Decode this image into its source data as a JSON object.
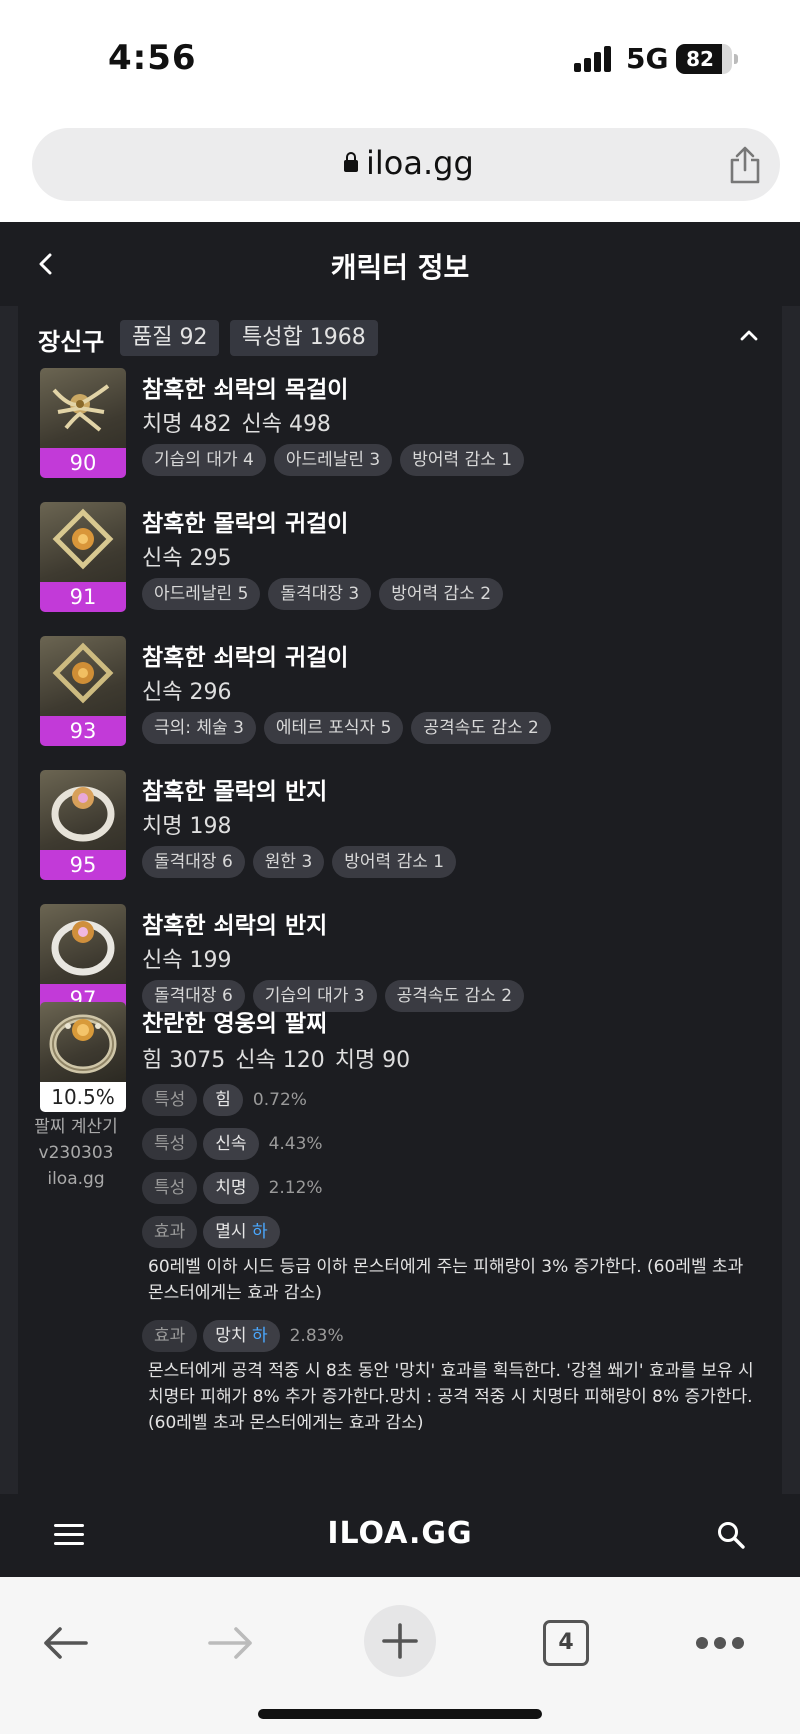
{
  "status": {
    "time": "4:56",
    "network": "5G",
    "battery": "82",
    "battery_level": 0.82
  },
  "browser": {
    "url": "iloa.gg",
    "tab_count": "4"
  },
  "header": {
    "title": "캐릭터 정보"
  },
  "section": {
    "title": "장신구",
    "quality": "품질 92",
    "stat_total": "특성합 1968"
  },
  "accessories": [
    {
      "name": "참혹한 쇠락의 목걸이",
      "quality": "90",
      "stats": [
        "치명 482",
        "신속 498"
      ],
      "engravings": [
        "기습의 대가 4",
        "아드레날린 3",
        "방어력 감소 1"
      ]
    },
    {
      "name": "참혹한 몰락의 귀걸이",
      "quality": "91",
      "stats": [
        "신속 295"
      ],
      "engravings": [
        "아드레날린 5",
        "돌격대장 3",
        "방어력 감소 2"
      ]
    },
    {
      "name": "참혹한 쇠락의 귀걸이",
      "quality": "93",
      "stats": [
        "신속 296"
      ],
      "engravings": [
        "극의: 체술 3",
        "에테르 포식자 5",
        "공격속도 감소 2"
      ]
    },
    {
      "name": "참혹한 몰락의 반지",
      "quality": "95",
      "stats": [
        "치명 198"
      ],
      "engravings": [
        "돌격대장 6",
        "원한 3",
        "방어력 감소 1"
      ]
    },
    {
      "name": "참혹한 쇠락의 반지",
      "quality": "97",
      "stats": [
        "신속 199"
      ],
      "engravings": [
        "돌격대장 6",
        "기습의 대가 3",
        "공격속도 감소 2"
      ]
    }
  ],
  "bracelet": {
    "name": "찬란한 영웅의 팔찌",
    "percent": "10.5%",
    "calc": [
      "팔찌 계산기",
      "v230303",
      "iloa.gg"
    ],
    "stats": [
      "힘 3075",
      "신속 120",
      "치명 90"
    ],
    "options": [
      {
        "type": "특성",
        "name": "힘",
        "grade": "",
        "value": "0.72%"
      },
      {
        "type": "특성",
        "name": "신속",
        "grade": "",
        "value": "4.43%"
      },
      {
        "type": "특성",
        "name": "치명",
        "grade": "",
        "value": "2.12%"
      },
      {
        "type": "효과",
        "name": "멸시",
        "grade": "하",
        "value": ""
      },
      {
        "type": "효과",
        "name": "망치",
        "grade": "하",
        "value": "2.83%"
      }
    ],
    "desc1": [
      "60레벨 이하 시드 등급 이하 몬스터에게 주는 피해량이 3% 증가한다. (60레벨 초과",
      "몬스터에게는 효과 감소)"
    ],
    "desc2": [
      "몬스터에게 공격 적중 시 8초 동안 '망치' 효과를 획득한다. '강철 쐐기' 효과를 보유 시",
      "치명타 피해가 8% 추가 증가한다.망치 : 공격 적중 시 치명타 피해량이 8% 증가한다.",
      "(60레벨 초과 몬스터에게는 효과 감소)"
    ]
  },
  "footer": {
    "logo": "ILOA.GG"
  },
  "colors": {
    "app_bg": "#1c1d21",
    "quality_badge": "#c23ad8",
    "grade_blue": "#4aa8ff"
  },
  "icons": [
    "lock-icon",
    "share-icon",
    "back-icon",
    "chevron-up-icon",
    "menu-icon",
    "search-icon",
    "arrow-left-icon",
    "arrow-right-icon",
    "plus-icon",
    "more-icon"
  ]
}
